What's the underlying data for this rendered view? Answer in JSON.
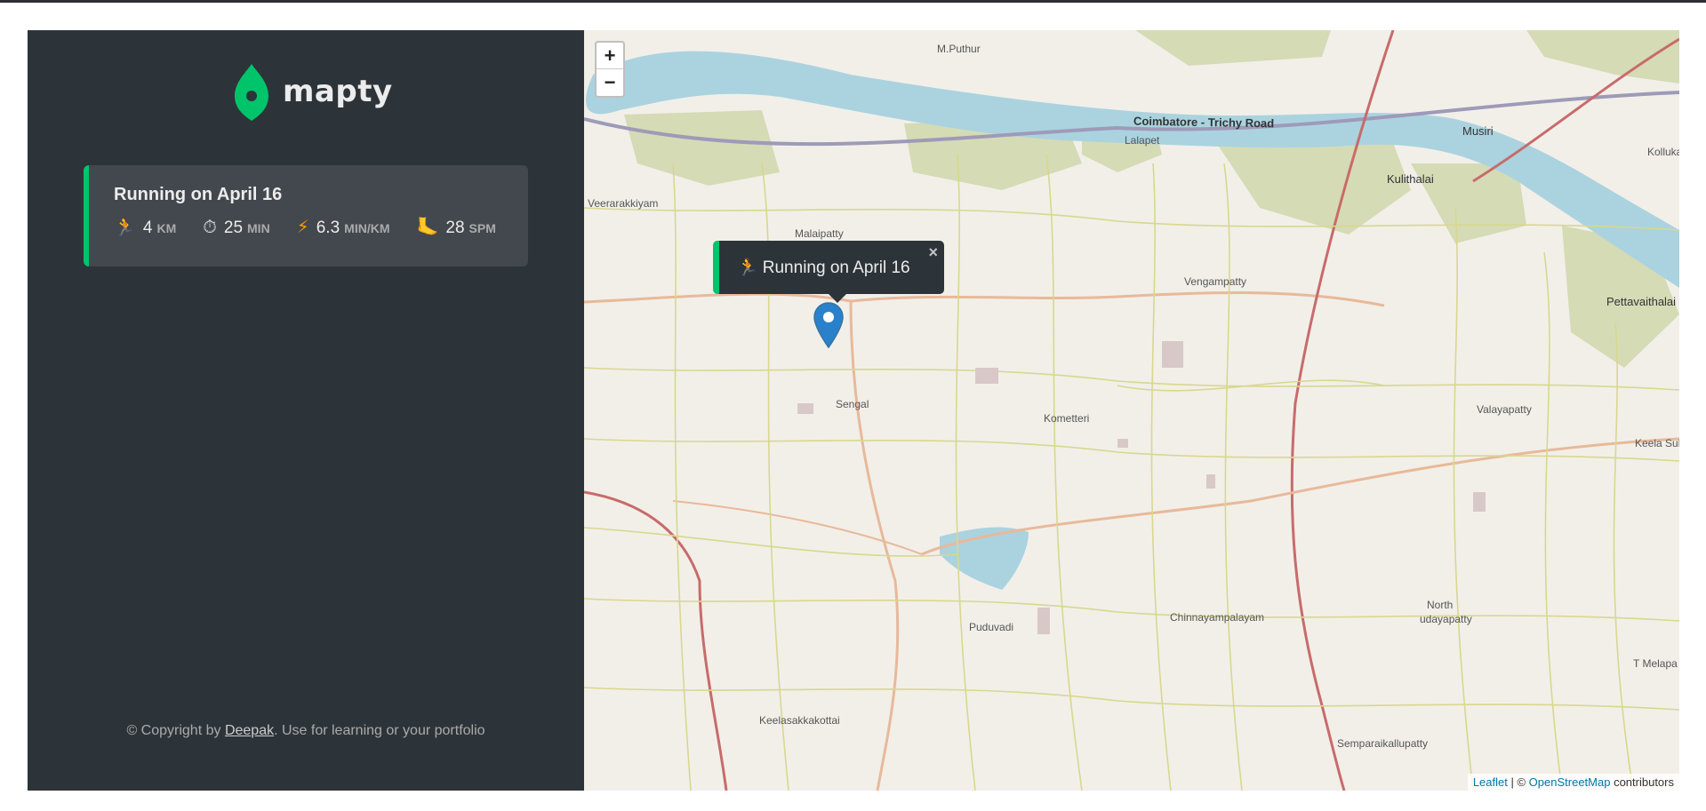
{
  "logo": {
    "text": "mapty"
  },
  "workouts": [
    {
      "title": "Running on April 16",
      "distance": {
        "icon": "🏃",
        "value": "4",
        "unit": "km"
      },
      "duration": {
        "icon": "⏱",
        "value": "25",
        "unit": "min"
      },
      "pace": {
        "icon": "⚡",
        "value": "6.3",
        "unit": "min/km"
      },
      "cadence": {
        "icon": "🦶",
        "value": "28",
        "unit": "spm"
      }
    }
  ],
  "copyright": {
    "prefix": "© Copyright by ",
    "author": "Deepak",
    "suffix": ". Use for learning or your portfolio"
  },
  "map": {
    "zoom_in": "+",
    "zoom_out": "−",
    "popup": {
      "icon": "🏃",
      "text": "Running on April 16",
      "close": "×"
    },
    "attribution": {
      "leaflet": "Leaflet",
      "sep": " | © ",
      "osm": "OpenStreetMap",
      "suffix": " contributors"
    },
    "places": {
      "m_puthur": "M.Puthur",
      "road": "Coimbatore - Trichy Road",
      "lalapet": "Lalapet",
      "musiri": "Musiri",
      "kollukal": "Kolluka",
      "kulithalai": "Kulithalai",
      "veerarakkiyam": "Veerarakkiyam",
      "malaipatty": "Malaipatty",
      "vengampatty": "Vengampatty",
      "pettavaithalai": "Pettavaithalai",
      "sengal": "Sengal",
      "kometteri": "Kometteri",
      "valayapatty": "Valayapatty",
      "keela_suk": "Keela Suk",
      "puduvadi": "Puduvadi",
      "chinnayampalayam": "Chinnayampalayam",
      "north_udayapatty_1": "North",
      "north_udayapatty_2": "udayapatty",
      "t_melapa": "T Melapa",
      "keelasakkakottai": "Keelasakkakottai",
      "semparaikallupatty": "Semparaikallupatty"
    }
  },
  "colors": {
    "accent": "#00c46a",
    "sidebar": "#2d3439",
    "card": "#42484d",
    "river": "#aad3df"
  }
}
